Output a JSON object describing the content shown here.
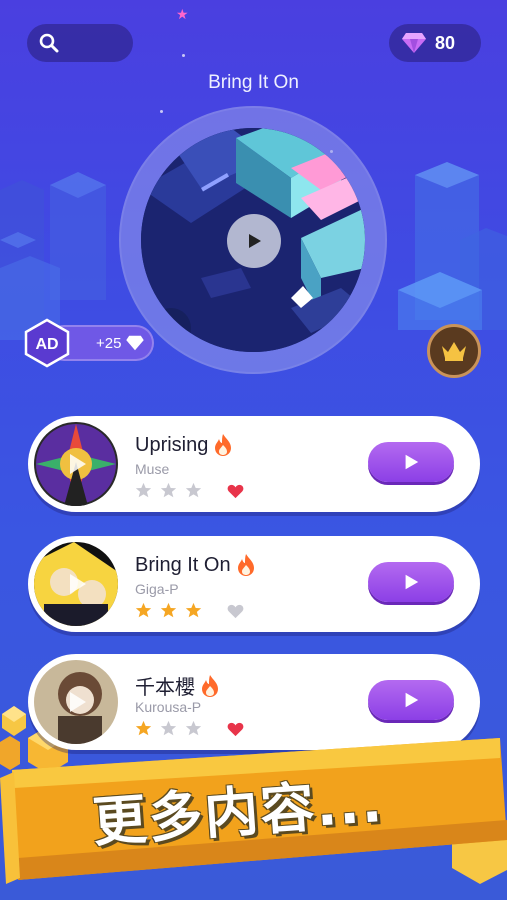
{
  "header": {
    "search_icon": "search-icon",
    "gem_icon": "gem-icon",
    "gem_count": "80"
  },
  "now_playing": {
    "title": "Bring It On"
  },
  "ad_reward": {
    "badge": "AD",
    "reward": "+25"
  },
  "songs": [
    {
      "title": "Uprising",
      "artist": "Muse",
      "stars_earned": 0,
      "stars_total": 3,
      "favorited": true
    },
    {
      "title": "Bring It On",
      "artist": "Giga-P",
      "stars_earned": 3,
      "stars_total": 3,
      "favorited": false
    },
    {
      "title": "千本櫻",
      "artist": "Kurousa-P",
      "stars_earned": 1,
      "stars_total": 3,
      "favorited": true
    }
  ],
  "banner": {
    "text": "更多内容..."
  },
  "colors": {
    "accent_purple": "#9a4ee8",
    "star_gold": "#f5a623",
    "heart_red": "#e8344a",
    "fire_orange": "#ff6a2a"
  }
}
